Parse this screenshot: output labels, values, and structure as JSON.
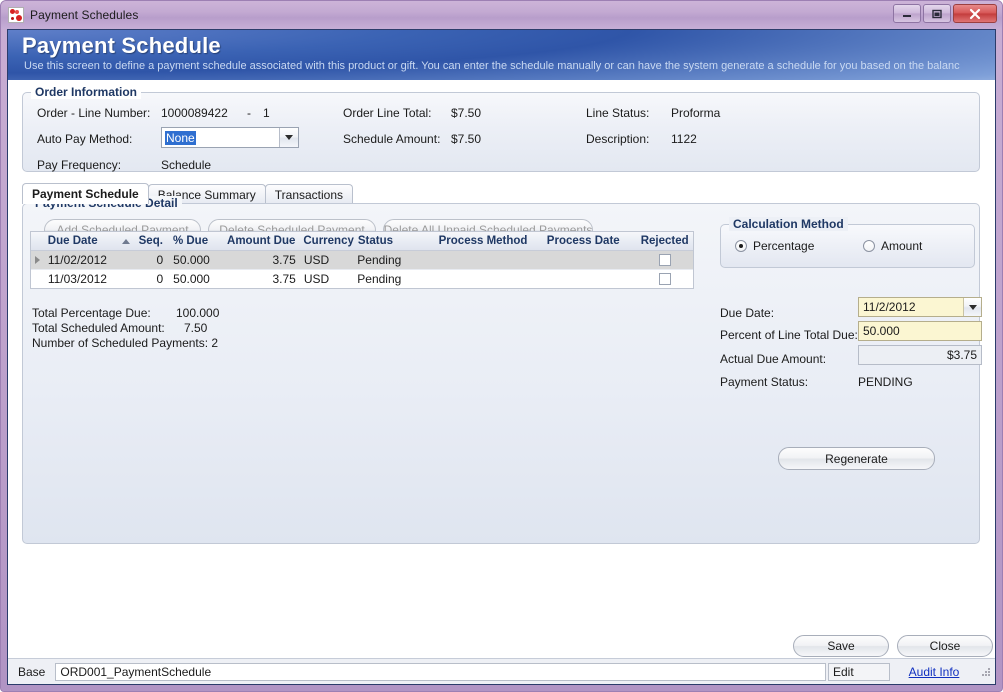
{
  "window": {
    "title": "Payment Schedules",
    "icon": "app-icon",
    "controls": {
      "minimize": "minimize",
      "maximize": "maximize",
      "close": "close"
    }
  },
  "banner": {
    "title": "Payment Schedule",
    "subtitle": "Use this screen to define a payment schedule associated with this product or gift. You can enter the schedule manually or can have the system generate a schedule for you based on the balanc"
  },
  "order_info": {
    "legend": "Order Information",
    "order_line_label": "Order - Line Number:",
    "order_number": "1000089422",
    "dash": "-",
    "line_number": "1",
    "auto_pay_label": "Auto Pay Method:",
    "auto_pay_value": "None",
    "pay_frequency_label": "Pay Frequency:",
    "pay_frequency_value": "Schedule",
    "order_line_total_label": "Order Line Total:",
    "order_line_total_value": "$7.50",
    "schedule_amount_label": "Schedule Amount:",
    "schedule_amount_value": "$7.50",
    "line_status_label": "Line Status:",
    "line_status_value": "Proforma",
    "description_label": "Description:",
    "description_value": "1122"
  },
  "tabs": [
    {
      "label": "Payment Schedule",
      "active": true
    },
    {
      "label": "Balance Summary",
      "active": false
    },
    {
      "label": "Transactions",
      "active": false
    }
  ],
  "detail": {
    "legend": "Payment Schedule Detail",
    "buttons": [
      {
        "label": "Add Scheduled Payment",
        "enabled": false
      },
      {
        "label": "Delete Scheduled Payment",
        "enabled": false
      },
      {
        "label": "Delete All Unpaid Scheduled Payments",
        "enabled": false
      }
    ],
    "grid": {
      "columns": [
        "Due Date",
        "Seq.",
        "% Due",
        "Amount Due",
        "Currency",
        "Status",
        "Process Method",
        "Process Date",
        "Rejected"
      ],
      "sort_column": "Due Date",
      "sort_direction": "ascending",
      "rows": [
        {
          "due_date": "11/02/2012",
          "seq": "0",
          "pct_due": "50.000",
          "amount_due": "3.75",
          "currency": "USD",
          "status": "Pending",
          "process_method": "",
          "process_date": "",
          "rejected": false,
          "selected": true
        },
        {
          "due_date": "11/03/2012",
          "seq": "0",
          "pct_due": "50.000",
          "amount_due": "3.75",
          "currency": "USD",
          "status": "Pending",
          "process_method": "",
          "process_date": "",
          "rejected": false,
          "selected": false
        }
      ]
    },
    "totals": {
      "total_percentage_label": "Total Percentage Due:",
      "total_percentage_value": "100.000",
      "total_amount_label": "Total Scheduled Amount:",
      "total_amount_value": "7.50",
      "count_label": "Number of Scheduled Payments: 2"
    }
  },
  "calc": {
    "legend": "Calculation Method",
    "option_percentage": "Percentage",
    "option_amount": "Amount",
    "selected_option": "Percentage",
    "due_date_label": "Due Date:",
    "due_date_value": "11/2/2012",
    "percent_label": "Percent of Line Total Due:",
    "percent_value": "50.000",
    "actual_label": "Actual Due Amount:",
    "actual_value": "$3.75",
    "status_label": "Payment Status:",
    "status_value": "PENDING",
    "regenerate_label": "Regenerate"
  },
  "footer": {
    "save_label": "Save",
    "close_label": "Close"
  },
  "statusbar": {
    "base_label": "Base",
    "form_name": "ORD001_PaymentSchedule",
    "mode": "Edit",
    "audit_link": "Audit Info"
  },
  "colors": {
    "banner_blue": "#2f55a8",
    "frame_purple": "#bfa3cd",
    "legend_navy": "#1f3864",
    "field_yellow": "#fbf6d2",
    "link_blue": "#1030c0",
    "selection_blue": "#2f6fd0",
    "row_selected_gray": "#d8d8d8",
    "close_red": "#c33c3c"
  }
}
